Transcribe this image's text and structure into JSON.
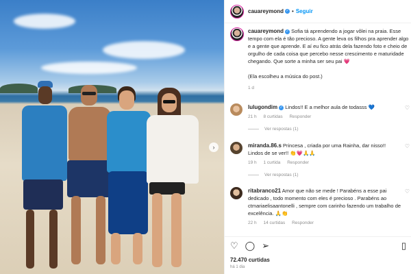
{
  "post": {
    "username": "cauareymond",
    "follow_label": "Seguir",
    "caption": "Sofia tá aprendendo a jogar vôlei na praia. Esse tempo com ela é tão precioso. A gente leva os filhos pra aprender algo e a gente que aprende. E aí eu fico atrás dela fazendo foto e cheio de orgulho de cada coisa que percebo nesse crescimento e maturidade chegando. Que sorte a minha ser seu pai",
    "caption_emoji": "💗",
    "caption_note": "(Ela escolheu a música do post.)",
    "caption_time": "1 d",
    "likes": "72.470 curtidas",
    "posted_ago": "há 1 dia"
  },
  "comments": [
    {
      "username": "lulugondim",
      "text": "Lindos!! E a melhor aula de todasss",
      "emoji": "💙",
      "time": "21 h",
      "likes": "8 curtidas",
      "reply_label": "Responder",
      "view_replies": "Ver respostas (1)"
    },
    {
      "username": "miranda.86.s",
      "text": "Princesa , criada por uma Rainha, dar nisso!! Lindos de se ver!!",
      "emoji": "👏💗🙏🙏",
      "time": "19 h",
      "likes": "1 curtida",
      "reply_label": "Responder",
      "view_replies": "Ver respostas (1)"
    },
    {
      "username": "ritabranco21",
      "text": "Amor que não se mede ! Parabéns a esse pai dedicado , todo momento com eles é precioso . Parabéns ao ctmariaelisaantonelli , sempre com carinho fazendo um trabalho de excelência.",
      "emoji": "🙏👏",
      "time": "22 h",
      "likes": "14 curtidas",
      "reply_label": "Responder"
    }
  ],
  "icons": {
    "like": "heart-icon",
    "comment": "comment-icon",
    "share": "share-icon",
    "save": "bookmark-icon",
    "next": "chevron-right-icon"
  },
  "colors": {
    "accent": "#0095f6",
    "verified": "#3897f0",
    "muted": "#8e8e8e"
  }
}
